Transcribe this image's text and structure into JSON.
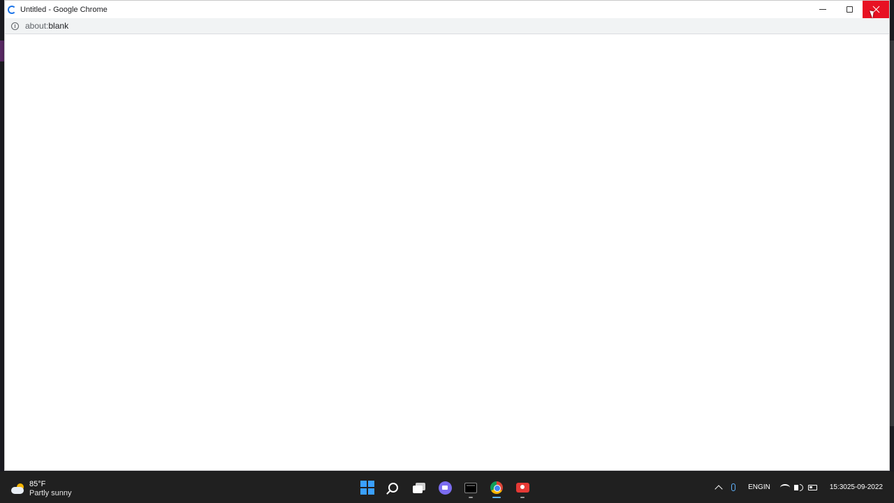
{
  "window": {
    "title": "Untitled - Google Chrome",
    "url_scheme": "about:",
    "url_path": "blank"
  },
  "taskbar": {
    "weather": {
      "temp": "85°F",
      "desc": "Partly sunny",
      "icon": "partly-sunny-icon"
    },
    "apps": [
      {
        "name": "start",
        "icon": "windows-logo-icon"
      },
      {
        "name": "search",
        "icon": "search-icon"
      },
      {
        "name": "task-view",
        "icon": "task-view-icon"
      },
      {
        "name": "chat",
        "icon": "chat-icon"
      },
      {
        "name": "terminal",
        "icon": "terminal-icon"
      },
      {
        "name": "chrome",
        "icon": "chrome-icon"
      },
      {
        "name": "recorder",
        "icon": "screen-recorder-icon"
      }
    ],
    "tray": {
      "lang_top": "ENG",
      "lang_bottom": "IN",
      "time": "15:30",
      "date": "25-09-2022"
    }
  },
  "colors": {
    "close_button": "#e81123",
    "taskbar": "#202020",
    "accent": "#60b4ff"
  }
}
